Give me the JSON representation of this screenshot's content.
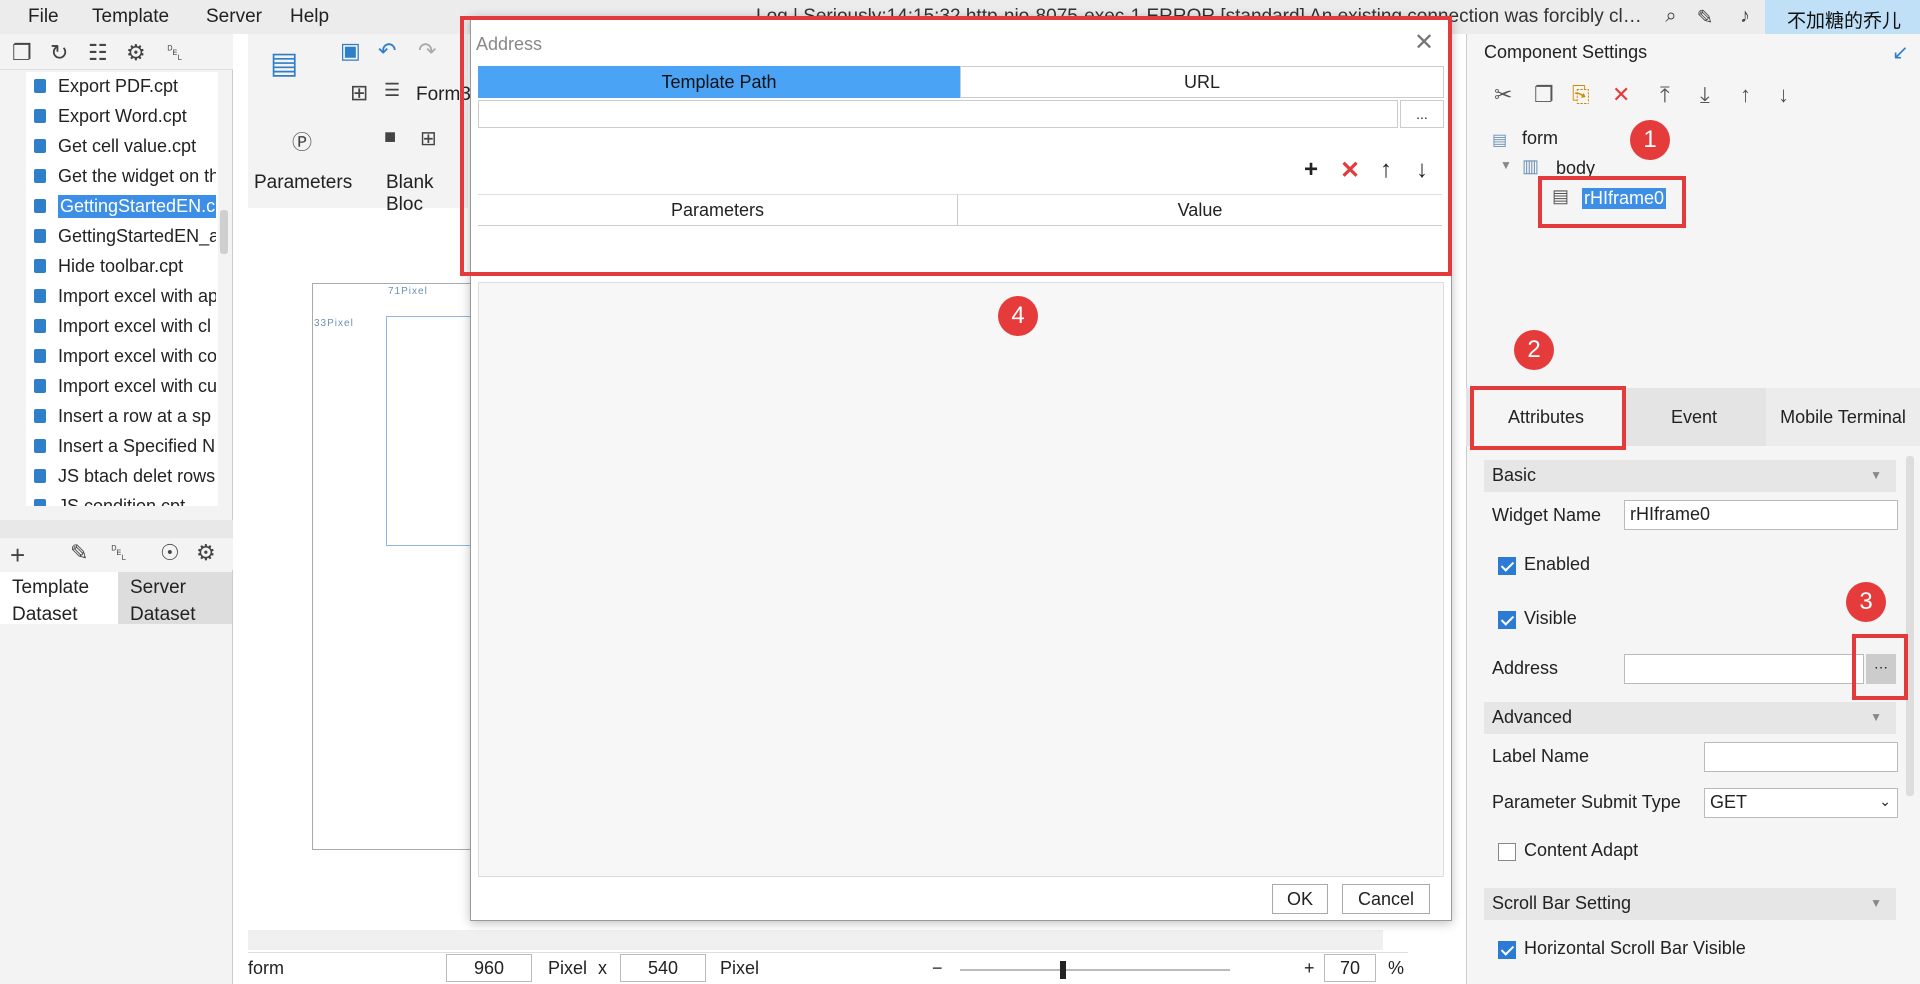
{
  "menu": {
    "items": [
      "File",
      "Template",
      "Server",
      "Help"
    ]
  },
  "log_text": "Log | Seriously:14:15:32 http-nio-8075-exec-1 ERROR [standard] An existing connection was forcibly closed ...",
  "user": "不加糖的乔儿",
  "left": {
    "files": [
      "Export PDF.cpt",
      "Export Word.cpt",
      "Get cell value.cpt",
      "Get the widget on th",
      "GettingStartedEN.c",
      "GettingStartedEN_a",
      "Hide toolbar.cpt",
      "Import excel with ap",
      "Import excel with cl",
      "Import excel with co",
      "Import excel with cu",
      "Insert a row at a sp",
      "Insert a Specified N",
      "JS btach delet rows",
      "JS condition.cpt"
    ],
    "selected_index": 4,
    "dataset_tabs": [
      "Template Dataset",
      "Server Dataset"
    ]
  },
  "center": {
    "tab_label": "Form3",
    "parameters_label": "Parameters",
    "blank_block_label": "Blank Bloc",
    "ruler_top": "71Pixel",
    "ruler_left": "33Pixel",
    "bottom": {
      "mode": "form",
      "width": "960",
      "width_unit": "Pixel",
      "x": "x",
      "height": "540",
      "height_unit": "Pixel",
      "zoom": "70",
      "zoom_unit": "%",
      "minus": "−",
      "plus": "+"
    }
  },
  "right": {
    "title": "Component Settings",
    "tree": {
      "root": "form",
      "body": "body",
      "widget": "rHIframe0"
    },
    "tabs": [
      "Attributes",
      "Event",
      "Mobile Terminal"
    ],
    "sections": {
      "basic": "Basic",
      "advanced": "Advanced",
      "scroll": "Scroll Bar Setting"
    },
    "widget_name_label": "Widget Name",
    "widget_name_value": "rHIframe0",
    "enabled_label": "Enabled",
    "visible_label": "Visible",
    "address_label": "Address",
    "address_value": "",
    "label_name_label": "Label Name",
    "label_name_value": "",
    "submit_type_label": "Parameter Submit Type",
    "submit_type_value": "GET",
    "content_adapt_label": "Content Adapt",
    "hscroll_label": "Horizontal Scroll Bar Visible"
  },
  "dialog": {
    "title": "Address",
    "tabs": [
      "Template Path",
      "URL"
    ],
    "path_value": "",
    "browse": "...",
    "col_params": "Parameters",
    "col_value": "Value",
    "ok": "OK",
    "cancel": "Cancel"
  },
  "annotations": {
    "one": "1",
    "two": "2",
    "three": "3",
    "four": "4"
  },
  "colors": {
    "accent": "#4aa3f5",
    "annotation_red": "#e33b3b",
    "selection": "#3d8ee6"
  }
}
